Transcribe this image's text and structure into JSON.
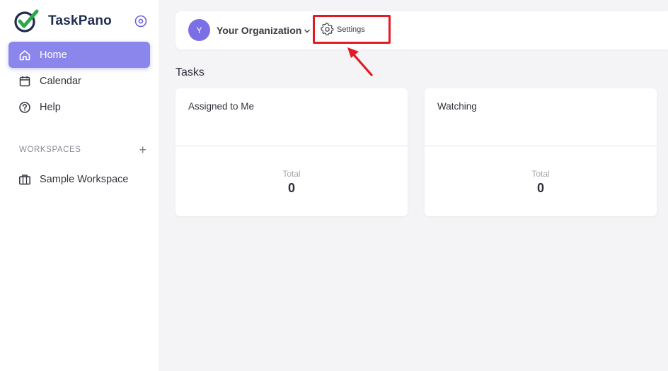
{
  "brand": {
    "name": "TaskPano"
  },
  "sidebar": {
    "nav": [
      {
        "label": "Home",
        "icon": "home-icon",
        "active": true
      },
      {
        "label": "Calendar",
        "icon": "calendar-icon",
        "active": false
      },
      {
        "label": "Help",
        "icon": "help-icon",
        "active": false
      }
    ],
    "workspaces_title": "WORKSPACES",
    "workspaces_add": "+",
    "workspaces": [
      {
        "label": "Sample Workspace",
        "icon": "briefcase-icon"
      }
    ]
  },
  "topbar": {
    "org_initial": "Y",
    "org_name": "Your Organization",
    "settings_label": "Settings"
  },
  "main": {
    "section_title": "Tasks",
    "cards": [
      {
        "title": "Assigned to Me",
        "total_label": "Total",
        "total_value": "0"
      },
      {
        "title": "Watching",
        "total_label": "Total",
        "total_value": "0"
      }
    ]
  },
  "colors": {
    "accent": "#8b86ec",
    "avatar": "#7b6fe6",
    "highlight": "#e01b24",
    "brand_text": "#1f2d4e"
  }
}
